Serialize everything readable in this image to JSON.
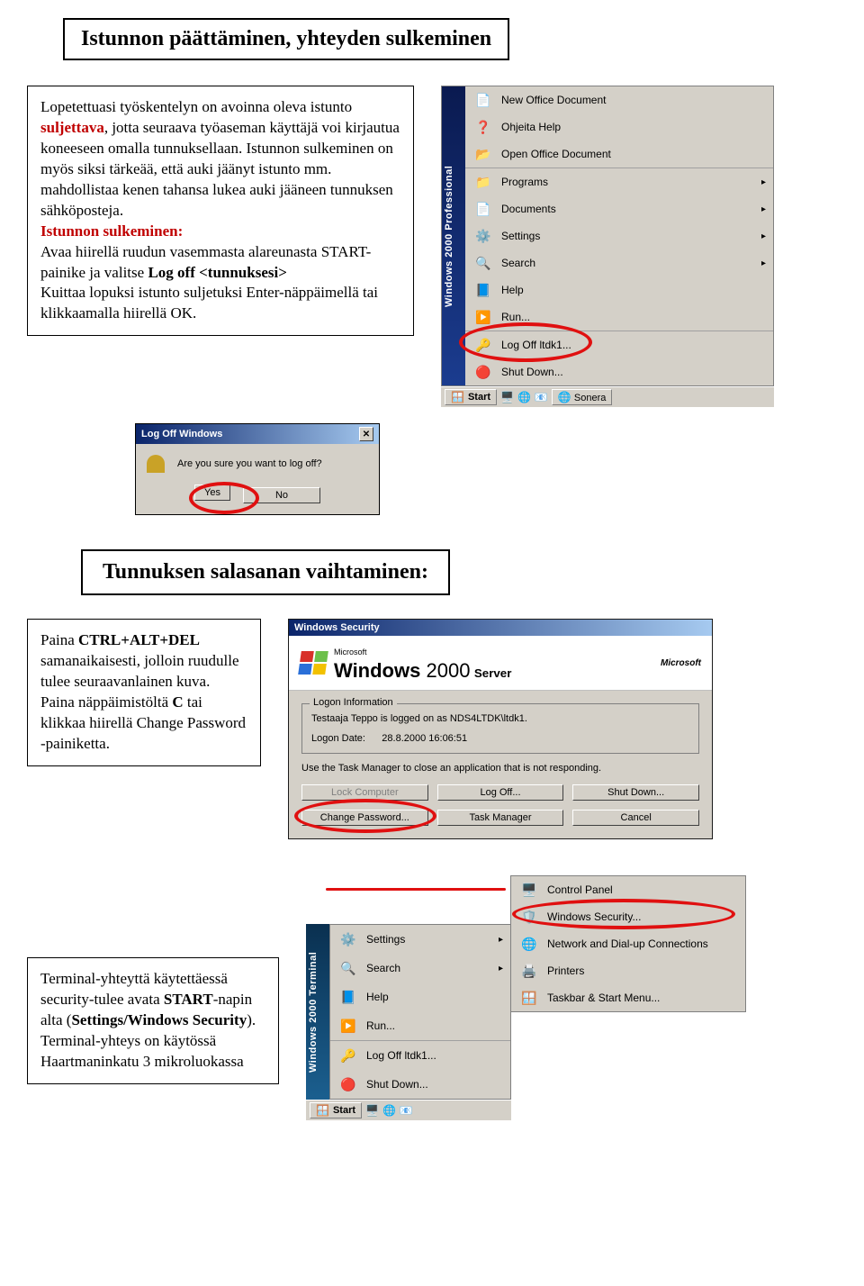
{
  "section1": {
    "title": "Istunnon päättäminen,  yhteyden sulkeminen",
    "para": "Lopetettuasi työskentelyn on avoinna oleva istunto ",
    "suljettava": "suljettava",
    "para2": ", jotta seuraava työaseman käyttäjä voi kirjautua koneeseen omalla tunnuksellaan. Istunnon sulkeminen on myös siksi tärkeää, että auki jäänyt istunto mm. mahdollistaa kenen tahansa lukea auki jääneen tunnuksen sähköposteja.",
    "sub_heading": "Istunnon sulkeminen:",
    "para3a": "Avaa hiirellä ruudun vasemmasta alareunasta START-painike ja valitse ",
    "logoff_bold": "Log off <tunnuksesi>",
    "para3b": "Kuittaa lopuksi istunto suljetuksi Enter-näppäimellä tai klikkaamalla hiirellä OK."
  },
  "start_menu": {
    "bar": "Windows 2000 Professional",
    "items": [
      {
        "icon": "📄",
        "label": "New Office Document"
      },
      {
        "icon": "❓",
        "label": "Ohjeita Help"
      },
      {
        "icon": "📂",
        "label": "Open Office Document"
      },
      {
        "icon": "📁",
        "label": "Programs",
        "arrow": true,
        "sep": true
      },
      {
        "icon": "📄",
        "label": "Documents",
        "arrow": true
      },
      {
        "icon": "⚙️",
        "label": "Settings",
        "arrow": true
      },
      {
        "icon": "🔍",
        "label": "Search",
        "arrow": true
      },
      {
        "icon": "📘",
        "label": "Help"
      },
      {
        "icon": "▶️",
        "label": "Run..."
      },
      {
        "icon": "🔑",
        "label": "Log Off ltdk1...",
        "sep": true
      },
      {
        "icon": "🔴",
        "label": "Shut Down..."
      }
    ],
    "taskbar": {
      "start": "Start",
      "app": "Sonera"
    }
  },
  "logoff_dialog": {
    "title": "Log Off Windows",
    "question": "Are you sure you want to log off?",
    "yes": "Yes",
    "no": "No"
  },
  "section2_title": "Tunnuksen salasanan vaihtaminen:",
  "section2_box": {
    "p1a": "Paina ",
    "ctrl": "CTRL+ALT+DEL",
    "p1b": " samanaikaisesti, jolloin ruudulle tulee seuraavanlainen kuva.",
    "p2a": "Paina näppäimistöltä ",
    "c": "C",
    "p2b": " tai klikkaa hiirellä Change Password -painiketta."
  },
  "sec_dialog": {
    "title": "Windows Security",
    "ms": "Microsoft",
    "product": "Windows",
    "ver": "2000",
    "edition": "Server",
    "legend": "Logon Information",
    "logged": "Testaaja Teppo is logged on as NDS4LTDK\\ltdk1.",
    "date_label": "Logon Date:",
    "date_val": "28.8.2000 16:06:51",
    "tip": "Use the Task Manager to close an application that is not responding.",
    "btns": [
      "Lock Computer",
      "Log Off...",
      "Shut Down...",
      "Change Password...",
      "Task Manager",
      "Cancel"
    ]
  },
  "section3_box": {
    "p1": "Terminal-yhteyttä käytettäessä security-tulee avata ",
    "start_bold": "START",
    "p2": "-napin alta (",
    "path": "Settings/Windows Security",
    "p3": ").",
    "p4": "Terminal-yhteys on käytössä Haartmaninkatu 3 mikroluokassa"
  },
  "term_menu": {
    "bar": "Windows 2000 Terminal",
    "items": [
      {
        "icon": "⚙️",
        "label": "Settings",
        "arrow": true
      },
      {
        "icon": "🔍",
        "label": "Search",
        "arrow": true
      },
      {
        "icon": "📘",
        "label": "Help"
      },
      {
        "icon": "▶️",
        "label": "Run..."
      },
      {
        "icon": "🔑",
        "label": "Log Off ltdk1...",
        "sep": true
      },
      {
        "icon": "🔴",
        "label": "Shut Down..."
      }
    ],
    "taskbar_start": "Start"
  },
  "submenu": {
    "items": [
      {
        "icon": "🖥️",
        "label": "Control Panel"
      },
      {
        "icon": "🛡️",
        "label": "Windows Security..."
      },
      {
        "icon": "🌐",
        "label": "Network and Dial-up Connections"
      },
      {
        "icon": "🖨️",
        "label": "Printers"
      },
      {
        "icon": "🪟",
        "label": "Taskbar & Start Menu..."
      }
    ]
  }
}
